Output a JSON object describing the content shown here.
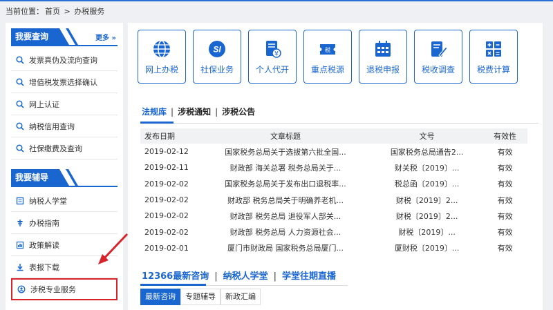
{
  "breadcrumb": {
    "label": "当前位置：",
    "home": "首页",
    "sep": ">",
    "current": "办税服务"
  },
  "sidebar": {
    "query_title": "我要查询",
    "more": "更多 »",
    "query_items": [
      {
        "label": "发票真伪及流向查询",
        "icon": "search-icon"
      },
      {
        "label": "增值税发票选择确认",
        "icon": "search-icon"
      },
      {
        "label": "网上认证",
        "icon": "search-icon"
      },
      {
        "label": "纳税信用查询",
        "icon": "search-icon"
      },
      {
        "label": "社保缴费及查询",
        "icon": "search-icon"
      }
    ],
    "guide_title": "我要辅导",
    "guide_items": [
      {
        "label": "纳税人学堂",
        "icon": "book-icon"
      },
      {
        "label": "办税指南",
        "icon": "guide-icon"
      },
      {
        "label": "政策解读",
        "icon": "chart-icon"
      },
      {
        "label": "表报下载",
        "icon": "download-icon"
      },
      {
        "label": "涉税专业服务",
        "icon": "service-icon"
      }
    ]
  },
  "tiles": [
    {
      "label": "网上办税",
      "icon": "globe-icon"
    },
    {
      "label": "社保业务",
      "icon": "social-security-icon"
    },
    {
      "label": "个人代开",
      "icon": "document-yen-icon"
    },
    {
      "label": "重点税源",
      "icon": "tax-ticket-icon"
    },
    {
      "label": "退税申报",
      "icon": "calendar-icon"
    },
    {
      "label": "税收调查",
      "icon": "edit-icon"
    },
    {
      "label": "税费计算",
      "icon": "calculator-icon"
    }
  ],
  "news_tabs": [
    "法规库",
    "涉税通知",
    "涉税公告"
  ],
  "table": {
    "headers": [
      "发布日期",
      "文章标题",
      "文号",
      "有效性"
    ],
    "rows": [
      [
        "2019-02-12",
        "国家税务总局关于选拔第六批全国...",
        "国家税务总局通告2...",
        "有效"
      ],
      [
        "2019-02-11",
        "财政部 海关总署 税务总局关于...",
        "财关税〔2019〕...",
        "有效"
      ],
      [
        "2019-02-02",
        "国家税务总局关于发布出口退税率...",
        "税总函〔2019〕...",
        "有效"
      ],
      [
        "2019-02-02",
        "财政部 税务总局关于明确养老机...",
        "财税〔2019〕2...",
        "有效"
      ],
      [
        "2019-02-02",
        "财政部 税务总局 退役军人部关...",
        "财税〔2019〕2...",
        "有效"
      ],
      [
        "2019-02-02",
        "财政部 税务总局 人力资源社会...",
        "财税〔2019〕...",
        "有效"
      ],
      [
        "2019-02-01",
        "厦门市财政局 国家税务总局厦门...",
        "厦财税〔2019〕...",
        "有效"
      ]
    ]
  },
  "consult_tabs": [
    "12366最新咨询",
    "纳税人学堂",
    "学堂往期直播"
  ],
  "sub_tabs": [
    "最新咨询",
    "专题辅导",
    "新政汇编"
  ],
  "colors": {
    "accent": "#1a66d0",
    "highlight": "#d8232a"
  }
}
